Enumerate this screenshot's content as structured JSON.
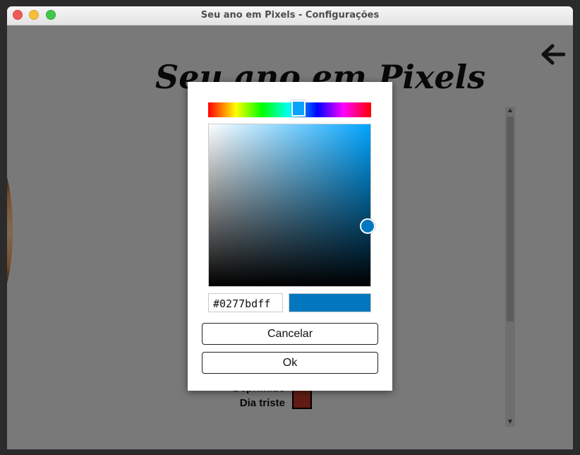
{
  "window": {
    "title": "Seu ano em Pixels - Configurações"
  },
  "app": {
    "heading": "Seu ano em Pixels"
  },
  "list": {
    "labels": [
      "Deprimido",
      "Dia triste"
    ],
    "swatch_color": "#c0392b"
  },
  "color_picker": {
    "hex_value": "#0277bdff",
    "preview_color": "#0277bd",
    "cancel_label": "Cancelar",
    "ok_label": "Ok"
  },
  "icons": {
    "back": "arrow-left-icon",
    "close": "close-icon",
    "minimize": "minimize-icon",
    "maximize": "maximize-icon"
  }
}
